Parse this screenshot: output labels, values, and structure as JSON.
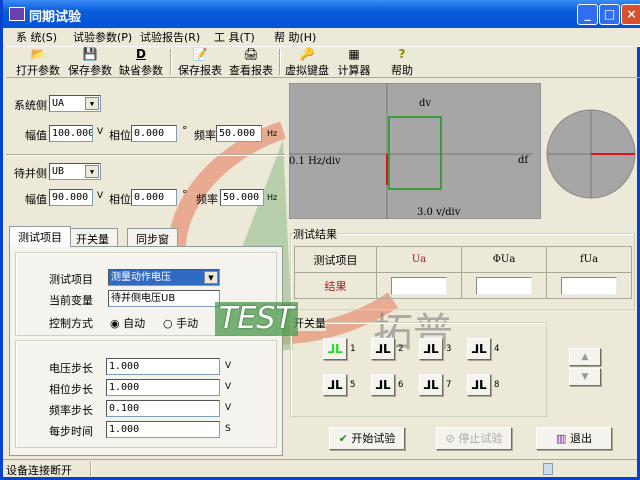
{
  "window": {
    "title": "同期试验",
    "minimize": "_",
    "maximize": "□",
    "close": "×"
  },
  "menu": [
    "系 统(S)",
    "试验参数(P)",
    "试验报告(R)",
    "工 具(T)",
    "帮 助(H)"
  ],
  "toolbar": [
    {
      "label": "打开参数",
      "icon": "folder-open-icon",
      "glyph": "📂"
    },
    {
      "label": "保存参数",
      "icon": "floppy-disk-icon",
      "glyph": "💾"
    },
    {
      "label": "缺省参数",
      "icon": "default-d-icon",
      "glyph": "D"
    },
    {
      "label": "保存报表",
      "icon": "save-report-icon",
      "glyph": "📝"
    },
    {
      "label": "查看报表",
      "icon": "printer-icon",
      "glyph": "🖨"
    },
    {
      "label": "虚拟键盘",
      "icon": "key-icon",
      "glyph": "🔑"
    },
    {
      "label": "计算器",
      "icon": "calculator-icon",
      "glyph": "▦"
    },
    {
      "label": "帮助",
      "icon": "help-bulb-icon",
      "glyph": "?"
    }
  ],
  "system_side": {
    "label": "系统侧",
    "channel": "UA",
    "amp_label": "幅值",
    "amp": "100.000",
    "amp_unit": "V",
    "phase_label": "相位",
    "phase": "0.000",
    "phase_unit": "°",
    "freq_label": "频率",
    "freq": "50.000",
    "freq_unit": "Hz"
  },
  "pending_side": {
    "label": "待并侧",
    "channel": "UB",
    "amp_label": "幅值",
    "amp": "90.000",
    "amp_unit": "V",
    "phase_label": "相位",
    "phase": "0.000",
    "phase_unit": "°",
    "freq_label": "频率",
    "freq": "50.000",
    "freq_unit": "Hz"
  },
  "plot": {
    "y_label": "dv",
    "x_label": "df",
    "x_scale": "0.1 Hz/div",
    "y_scale": "3.0 v/div",
    "colors": {
      "bg": "#a6a6a6",
      "box": "#1a9a1a",
      "marker": "#e01020"
    }
  },
  "tabs": [
    "测试项目",
    "开关量",
    "同步窗"
  ],
  "test": {
    "item_label": "测试项目",
    "item_value": "测量动作电压",
    "var_label": "当前变量",
    "var_value": "待并侧电压UB",
    "mode_label": "控制方式",
    "mode_auto": "自动",
    "mode_manual": "手动",
    "mode_selected": "自动",
    "steps": [
      {
        "label": "电压步长",
        "value": "1.000",
        "unit": "V"
      },
      {
        "label": "相位步长",
        "value": "1.000",
        "unit": "V"
      },
      {
        "label": "频率步长",
        "value": "0.100",
        "unit": "V"
      },
      {
        "label": "每步时间",
        "value": "1.000",
        "unit": "S"
      }
    ]
  },
  "results": {
    "title": "测试结果",
    "headers": [
      "测试项目",
      "Ua",
      "ΦUa",
      "fUa"
    ],
    "row_label": "结果",
    "values": [
      "",
      "",
      ""
    ]
  },
  "switches": {
    "title": "开关量",
    "items": [
      "1",
      "2",
      "3",
      "4",
      "5",
      "6",
      "7",
      "8"
    ],
    "active": [
      "1"
    ],
    "glyph": "⅃L"
  },
  "buttons": {
    "start": "开始试验",
    "stop": "停止试验",
    "exit": "退出",
    "up": "▲",
    "down": "▼"
  },
  "status": {
    "text": "设备连接断开"
  },
  "watermark": {
    "text1": "TEST",
    "text2": "拓普"
  }
}
